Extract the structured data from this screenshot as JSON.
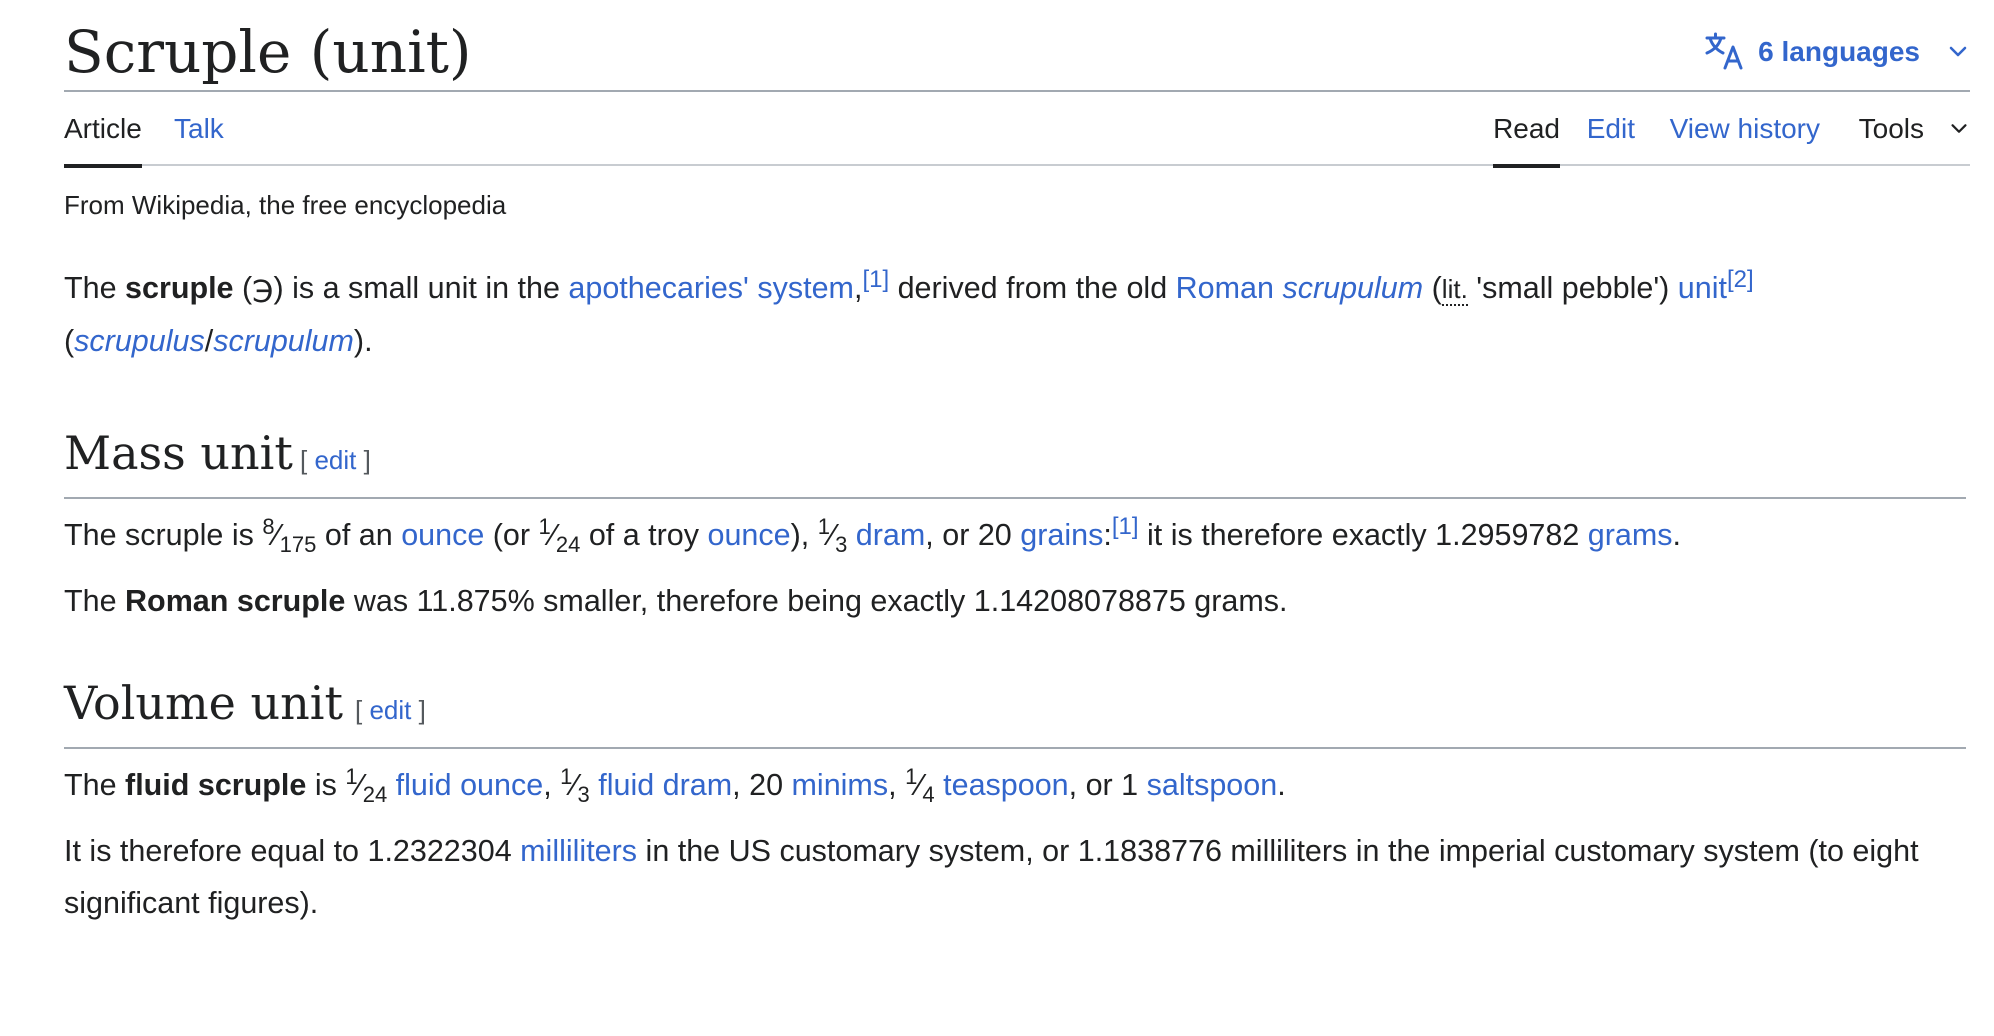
{
  "header": {
    "title": "Scruple (unit)",
    "languages_label": "6 languages",
    "icons": {
      "language": "translate-icon",
      "chevron": "chevron-down-icon"
    }
  },
  "tabs": {
    "left": [
      {
        "label": "Article",
        "active": true
      },
      {
        "label": "Talk",
        "active": false
      }
    ],
    "right": [
      {
        "label": "Read",
        "active": true
      },
      {
        "label": "Edit",
        "active": false
      },
      {
        "label": "View history",
        "active": false
      },
      {
        "label": "Tools",
        "active": false
      }
    ]
  },
  "tagline": "From Wikipedia, the free encyclopedia",
  "intro": {
    "t1": "The ",
    "b_scruple": "scruple",
    "t2": " (℈) is a small unit in the ",
    "link_apoth": "apothecaries' system",
    "t3": ",",
    "ref1": "[1]",
    "t4": " derived from the old ",
    "link_roman": "Roman",
    "t5": " ",
    "i_scrupulum": "scrupulum",
    "t6": " (",
    "abbr_lit": "lit.",
    "t7": " 'small pebble') ",
    "link_unit": "unit",
    "ref2": "[2]",
    "t8": " (",
    "link_scrupulus": "scrupulus",
    "t9": "/",
    "link_scrupulum": "scrupulum",
    "t10": ")."
  },
  "sections": {
    "mass": {
      "title": "Mass unit",
      "edit_open": "[ ",
      "edit_label": "edit",
      "edit_close": " ]"
    },
    "volume": {
      "title": "Volume unit",
      "edit_open": "[ ",
      "edit_label": "edit",
      "edit_close": " ]"
    }
  },
  "mass_p1": {
    "t1": "The scruple is ",
    "f1_num": "8",
    "f1_den": "175",
    "t2": " of an ",
    "link_ounce1": "ounce",
    "t3": " (or ",
    "f2_num": "1",
    "f2_den": "24",
    "t4": " of a troy ",
    "link_ounce2": "ounce",
    "t5": "), ",
    "f3_num": "1",
    "f3_den": "3",
    "t6": " ",
    "link_dram": "dram",
    "t7": ", or 20 ",
    "link_grains": "grains",
    "t8": ":",
    "ref1": "[1]",
    "t9": " it is therefore exactly 1.2959782 ",
    "link_grams": "grams",
    "t10": "."
  },
  "mass_p2": {
    "t1": "The ",
    "b_roman": "Roman scruple",
    "t2": " was 11.875% smaller, therefore being exactly 1.14208078875 grams."
  },
  "vol_p1": {
    "t1": "The ",
    "b_fluid": "fluid scruple",
    "t2": " is ",
    "f1_num": "1",
    "f1_den": "24",
    "t3": " ",
    "link_floz": "fluid ounce",
    "t4": ", ",
    "f2_num": "1",
    "f2_den": "3",
    "t5": " ",
    "link_fldram": "fluid dram",
    "t6": ", 20 ",
    "link_minims": "minims",
    "t7": ", ",
    "f3_num": "1",
    "f3_den": "4",
    "t8": " ",
    "link_teaspoon": "teaspoon",
    "t9": ", or 1 ",
    "link_saltspoon": "saltspoon",
    "t10": "."
  },
  "vol_p2": {
    "t1": "It is therefore equal to 1.2322304 ",
    "link_ml": "milliliters",
    "t2": " in the US customary system, or 1.1838776 milliliters in the imperial customary system (to eight significant figures)."
  },
  "colors": {
    "link": "#3366cc",
    "text": "#202122",
    "rule": "#a2a9b1"
  }
}
